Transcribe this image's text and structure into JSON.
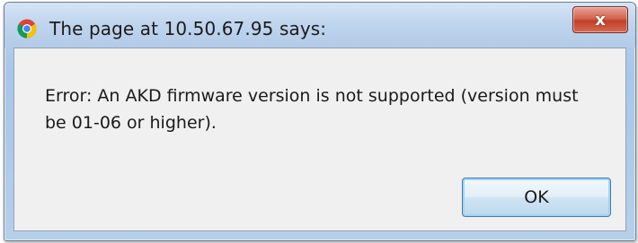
{
  "dialog": {
    "title": "The page at 10.50.67.95 says:",
    "close_label": "x",
    "message": "Error: An AKD firmware version is not supported (version must be 01-06 or higher).",
    "ok_label": "OK"
  },
  "icons": {
    "app_icon": "chrome-icon",
    "close_icon": "close-icon"
  },
  "colors": {
    "titlebar": "#c0d5ee",
    "close_button": "#c0402a",
    "client_background": "#f0f0f0",
    "ok_button_border": "#3c7fb1"
  }
}
